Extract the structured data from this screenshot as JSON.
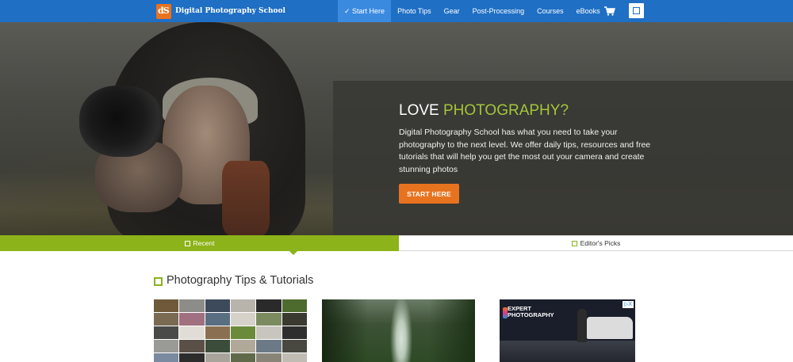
{
  "nav": {
    "brand_logo_text": "dPS",
    "brand_name": "Digital Photography School",
    "items": [
      {
        "label": "✓ Start Here",
        "active": true
      },
      {
        "label": "Photo Tips",
        "active": false
      },
      {
        "label": "Gear",
        "active": false
      },
      {
        "label": "Post-Processing",
        "active": false
      },
      {
        "label": "Courses",
        "active": false
      },
      {
        "label": "eBooks",
        "active": false
      }
    ],
    "cart_icon": "cart-icon",
    "menu_icon": "square-icon"
  },
  "hero": {
    "title_part1": "LOVE ",
    "title_part2": "PHOTOGRAPHY?",
    "text": "Digital Photography School has what you need to take your photography to the next level. We offer daily tips, resources and free tutorials that will help you get the most out your camera and create stunning photos",
    "button": "START HERE"
  },
  "tabs": {
    "recent": "Recent",
    "editors": "Editor's Picks"
  },
  "section": {
    "title": "Photography Tips & Tutorials"
  },
  "ad": {
    "badge": "▷X",
    "brand_line1": "EXPERT",
    "brand_line2": "PHOTOGRAPHY"
  },
  "colors": {
    "nav_blue": "#1f6fc4",
    "accent_green": "#8cb319",
    "title_green": "#a4c639",
    "orange": "#e8731f"
  }
}
